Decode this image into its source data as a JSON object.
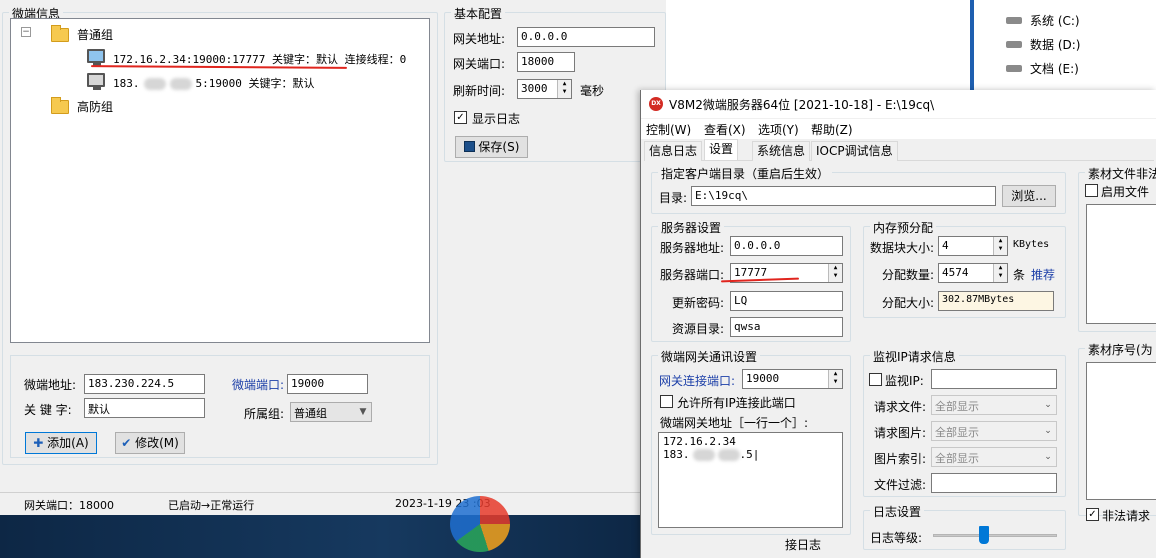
{
  "gateway_panel": {
    "group_title": "微端信息",
    "tree": {
      "group_normal": "普通组",
      "server1": "172.16.2.34:19000:17777 关键字：默认 连接线程：0",
      "server2_prefix": "183.",
      "server2_suffix": "5:19000 关键字：默认",
      "group_ddos": "高防组",
      "expand_marker": "−"
    },
    "form": {
      "addr_label": "微端地址:",
      "addr_value": "183.230.224.5",
      "port_label": "微端端口:",
      "port_value": "19000",
      "keyword_label": "关 键 字:",
      "keyword_value": "默认",
      "group_label": "所属组:",
      "group_value": "普通组",
      "add_button": "添加(A)",
      "modify_button": "修改(M)"
    }
  },
  "basic_config": {
    "title": "基本配置",
    "gateway_addr_label": "网关地址:",
    "gateway_addr_value": "0.0.0.0",
    "gateway_port_label": "网关端口:",
    "gateway_port_value": "18000",
    "refresh_label": "刷新时间:",
    "refresh_value": "3000",
    "refresh_unit": "毫秒",
    "show_log_label": "显示日志",
    "save_button": "保存(S)"
  },
  "status_bar": {
    "port": "网关端口：18000",
    "state": "已启动→正常运行",
    "time": "2023-1-19 23   :03"
  },
  "explorer": {
    "drives": [
      "系统 (C:)",
      "数据 (D:)",
      "文档 (E:)"
    ]
  },
  "server_window": {
    "title": "V8M2微端服务器64位 [2021-10-18] - E:\\19cq\\",
    "app_icon_text": "DX",
    "menu": [
      "控制(W)",
      "查看(X)",
      "选项(Y)",
      "帮助(Z)"
    ],
    "tabs": [
      "信息日志",
      "设置",
      "系统信息",
      "IOCP调试信息"
    ],
    "client_dir": {
      "title": "指定客户端目录（重启后生效）",
      "label": "目录:",
      "value": "E:\\19cq\\",
      "browse_button": "浏览..."
    },
    "server_settings": {
      "title": "服务器设置",
      "addr_label": "服务器地址:",
      "addr_value": "0.0.0.0",
      "port_label": "服务器端口:",
      "port_value": "17777",
      "pwd_label": "更新密码:",
      "pwd_value": "LQ",
      "res_label": "资源目录:",
      "res_value": "qwsa"
    },
    "memory": {
      "title": "内存预分配",
      "block_label": "数据块大小:",
      "block_value": "4",
      "block_unit": "KBytes",
      "count_label": "分配数量:",
      "count_value": "4574",
      "count_unit": "条",
      "recommend": "推荐",
      "size_label": "分配大小:",
      "size_value": "302.87MBytes"
    },
    "gateway_comm": {
      "title": "微端网关通讯设置",
      "port_label": "网关连接端口:",
      "port_value": "19000",
      "allow_all_label": "允许所有IP连接此端口",
      "list_label": "微端网关地址［一行一个］:",
      "list_line1": "172.16.2.34",
      "list_line2_prefix": "183.",
      "list_line2_suffix": ".5"
    },
    "monitor": {
      "title": "监视IP请求信息",
      "ip_label": "监视IP:",
      "file_label": "请求文件:",
      "file_value": "全部显示",
      "image_label": "请求图片:",
      "image_value": "全部显示",
      "index_label": "图片索引:",
      "index_value": "全部显示",
      "filter_label": "文件过滤:"
    },
    "log_settings": {
      "title": "日志设置",
      "level_label": "日志等级:",
      "level_fraction": 0.4
    },
    "bottom_hint": "接日志",
    "material": {
      "title": "素材文件非法",
      "enable_label": "启用文件",
      "seq_label": "素材序号(为",
      "illegal_label": "非法请求"
    }
  },
  "colors": {
    "highlight_red": "#e0251e",
    "taskbar": "#0f2a4a",
    "link_blue": "#1c3fa8"
  }
}
